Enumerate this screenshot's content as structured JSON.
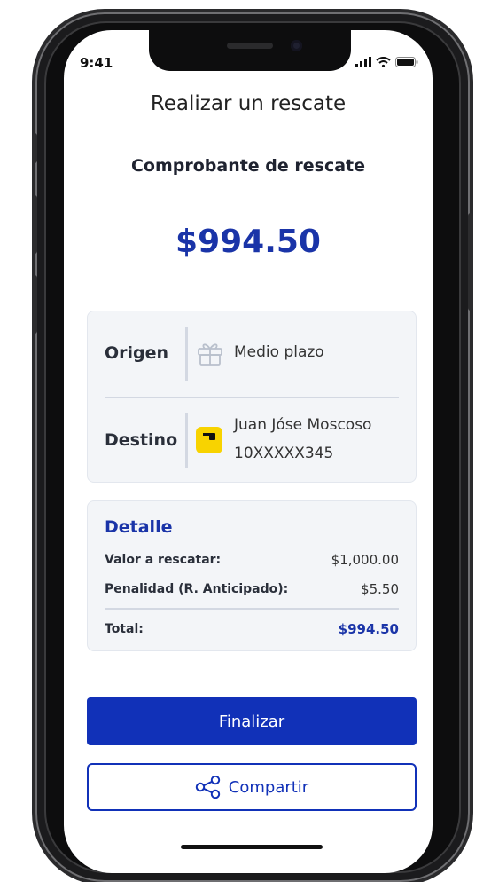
{
  "status_bar": {
    "time": "9:41"
  },
  "header": {
    "title": "Realizar un rescate"
  },
  "receipt": {
    "subtitle": "Comprobante de rescate",
    "amount": "$994.50"
  },
  "transfer": {
    "origin_label": "Origen",
    "origin_value": "Medio plazo",
    "origin_icon": "gift-icon",
    "destination_label": "Destino",
    "destination_name": "Juan Jóse Moscoso",
    "destination_account": "10XXXXX345",
    "destination_icon": "bank-logo-icon"
  },
  "detail": {
    "title": "Detalle",
    "rows": [
      {
        "label": "Valor a rescatar:",
        "value": "$1,000.00"
      },
      {
        "label": "Penalidad (R. Anticipado):",
        "value": "$5.50"
      }
    ],
    "total_label": "Total:",
    "total_value": "$994.50"
  },
  "actions": {
    "finish_label": "Finalizar",
    "share_label": "Compartir",
    "share_icon": "share-icon"
  },
  "colors": {
    "accent": "#1131b8",
    "amount": "#1a34a8",
    "brand_yellow": "#f8d300",
    "card_bg": "#f3f5f8"
  }
}
